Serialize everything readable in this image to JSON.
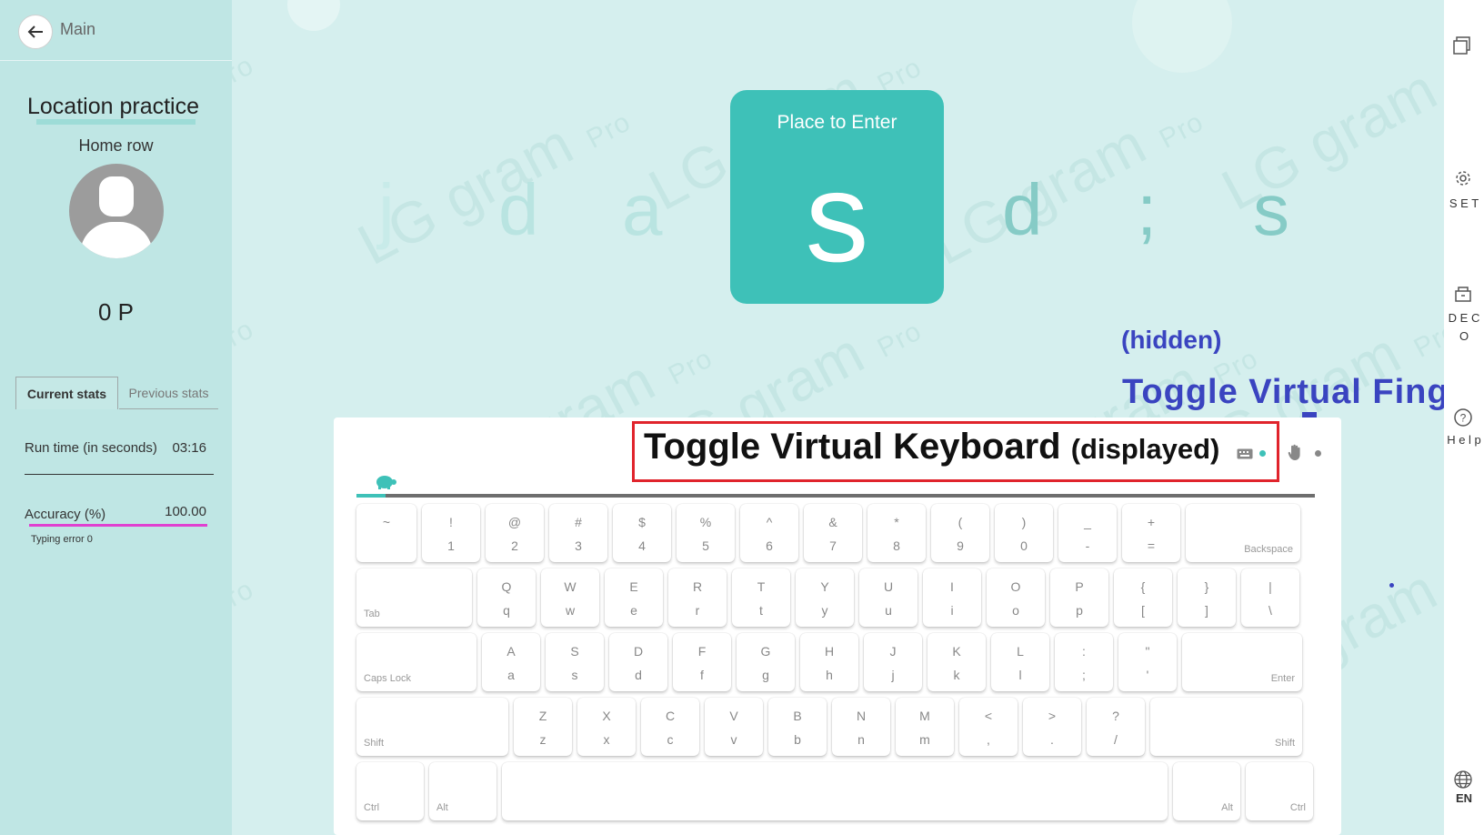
{
  "nav": {
    "back_label": "Main"
  },
  "practice": {
    "title": "Location practice",
    "subtitle": "Home row",
    "points": "0 P"
  },
  "stats": {
    "tabs": [
      "Current stats",
      "Previous stats"
    ],
    "runtime_label": "Run time (in seconds)",
    "runtime_value": "03:16",
    "accuracy_label": "Accuracy (%)",
    "accuracy_value": "100.00",
    "typing_error": "Typing error 0"
  },
  "watermark": {
    "brand": "LG gram",
    "suffix": "Pro",
    "fragment": "ro"
  },
  "sequence": [
    "j",
    "d",
    "a",
    "d",
    ";",
    "s"
  ],
  "target": {
    "label": "Place to Enter",
    "key": "s"
  },
  "annotations": {
    "hidden": "(hidden)",
    "toggle_fingers": "Toggle Virtual Fingers",
    "toggle_keyboard": "Toggle Virtual Keyboard",
    "displayed": "(displayed)"
  },
  "sidebar": {
    "set": "S E T",
    "deco": "D E C O",
    "help": "H e l p",
    "language": "EN"
  },
  "icons": [
    "back-arrow-icon",
    "window-icon",
    "gear-icon",
    "cart-icon",
    "help-icon",
    "globe-icon",
    "turtle-icon",
    "keyboard-icon",
    "hand-icon",
    "arrow-down-icon"
  ],
  "progress": {
    "fraction": 0.03
  },
  "keyboard": {
    "rows": [
      [
        {
          "u": "~",
          "l": ""
        },
        {
          "u": "!",
          "l": "1"
        },
        {
          "u": "@",
          "l": "2"
        },
        {
          "u": "#",
          "l": "3"
        },
        {
          "u": "$",
          "l": "4"
        },
        {
          "u": "%",
          "l": "5"
        },
        {
          "u": "^",
          "l": "6"
        },
        {
          "u": "&",
          "l": "7"
        },
        {
          "u": "*",
          "l": "8"
        },
        {
          "u": "(",
          "l": "9"
        },
        {
          "u": ")",
          "l": "0"
        },
        {
          "u": "_",
          "l": "-"
        },
        {
          "u": "+",
          "l": "="
        },
        {
          "br": "Backspace"
        }
      ],
      [
        {
          "bl": "Tab"
        },
        {
          "u": "Q",
          "l": "q"
        },
        {
          "u": "W",
          "l": "w"
        },
        {
          "u": "E",
          "l": "e"
        },
        {
          "u": "R",
          "l": "r"
        },
        {
          "u": "T",
          "l": "t"
        },
        {
          "u": "Y",
          "l": "y"
        },
        {
          "u": "U",
          "l": "u"
        },
        {
          "u": "I",
          "l": "i"
        },
        {
          "u": "O",
          "l": "o"
        },
        {
          "u": "P",
          "l": "p"
        },
        {
          "u": "{",
          "l": "["
        },
        {
          "u": "}",
          "l": "]"
        },
        {
          "u": "|",
          "l": "\\"
        }
      ],
      [
        {
          "bl": "Caps Lock"
        },
        {
          "u": "A",
          "l": "a"
        },
        {
          "u": "S",
          "l": "s"
        },
        {
          "u": "D",
          "l": "d"
        },
        {
          "u": "F",
          "l": "f"
        },
        {
          "u": "G",
          "l": "g"
        },
        {
          "u": "H",
          "l": "h"
        },
        {
          "u": "J",
          "l": "j"
        },
        {
          "u": "K",
          "l": "k"
        },
        {
          "u": "L",
          "l": "l"
        },
        {
          "u": ":",
          "l": ";"
        },
        {
          "u": "\"",
          "l": "'"
        },
        {
          "br": "Enter"
        }
      ],
      [
        {
          "bl": "Shift"
        },
        {
          "u": "Z",
          "l": "z"
        },
        {
          "u": "X",
          "l": "x"
        },
        {
          "u": "C",
          "l": "c"
        },
        {
          "u": "V",
          "l": "v"
        },
        {
          "u": "B",
          "l": "b"
        },
        {
          "u": "N",
          "l": "n"
        },
        {
          "u": "M",
          "l": "m"
        },
        {
          "u": "<",
          "l": ","
        },
        {
          "u": ">",
          "l": "."
        },
        {
          "u": "?",
          "l": "/"
        },
        {
          "br": "Shift"
        }
      ],
      [
        {
          "bl": "Ctrl"
        },
        {
          "bl": "Alt"
        },
        {
          "u": "",
          "l": ""
        },
        {
          "br": "Alt"
        },
        {
          "br": "Ctrl"
        }
      ]
    ]
  },
  "colors": {
    "accent": "#3ec1b8",
    "annotation": "#3a44c0",
    "highlight": "#e0242c",
    "accuracy_bar": "#e040d0"
  }
}
